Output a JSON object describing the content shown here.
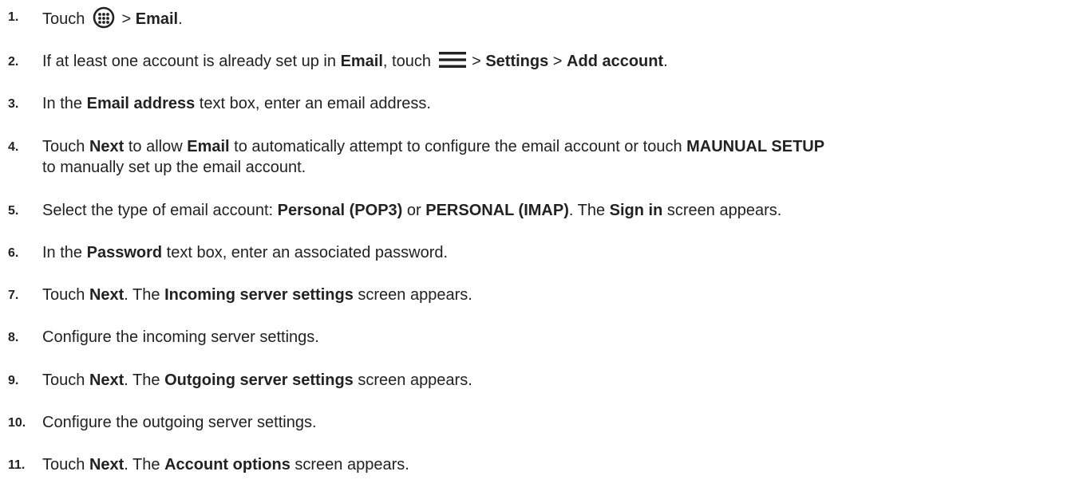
{
  "icons": {
    "apps": "apps-grid-icon",
    "menu": "menu-icon"
  },
  "steps": [
    {
      "num": "1.",
      "parts": [
        "Touch ",
        "[apps-icon]",
        " > ",
        "Email",
        "."
      ]
    },
    {
      "num": "2.",
      "parts": [
        "If at least one account is already set up in ",
        "Email",
        ", touch ",
        "[menu-icon]",
        " > ",
        "Settings",
        " > ",
        "Add account",
        "."
      ]
    },
    {
      "num": "3.",
      "parts": [
        "In the ",
        "Email address",
        " text box, enter an email address."
      ]
    },
    {
      "num": "4.",
      "parts": [
        "Touch ",
        "Next",
        " to allow ",
        "Email",
        " to automatically attempt to configure the email account or touch ",
        "MAUNUAL SETUP"
      ],
      "line2": "to manually set up the email account."
    },
    {
      "num": "5.",
      "parts": [
        "Select the type of email account: ",
        "Personal (POP3)",
        " or ",
        "PERSONAL (IMAP)",
        ". The ",
        "Sign in",
        " screen appears."
      ]
    },
    {
      "num": "6.",
      "parts": [
        "In the ",
        "Password",
        " text box, enter an associated password."
      ]
    },
    {
      "num": "7.",
      "parts": [
        "Touch ",
        "Next",
        ". The ",
        "Incoming server settings",
        " screen appears."
      ]
    },
    {
      "num": "8.",
      "parts": [
        "Configure the incoming server settings."
      ]
    },
    {
      "num": "9.",
      "parts": [
        "Touch ",
        "Next",
        ". The ",
        "Outgoing server settings",
        " screen appears."
      ]
    },
    {
      "num": "10.",
      "parts": [
        "Configure the outgoing server settings."
      ]
    },
    {
      "num": "11.",
      "parts": [
        "Touch ",
        "Next",
        ". The ",
        "Account options",
        " screen appears."
      ]
    }
  ]
}
